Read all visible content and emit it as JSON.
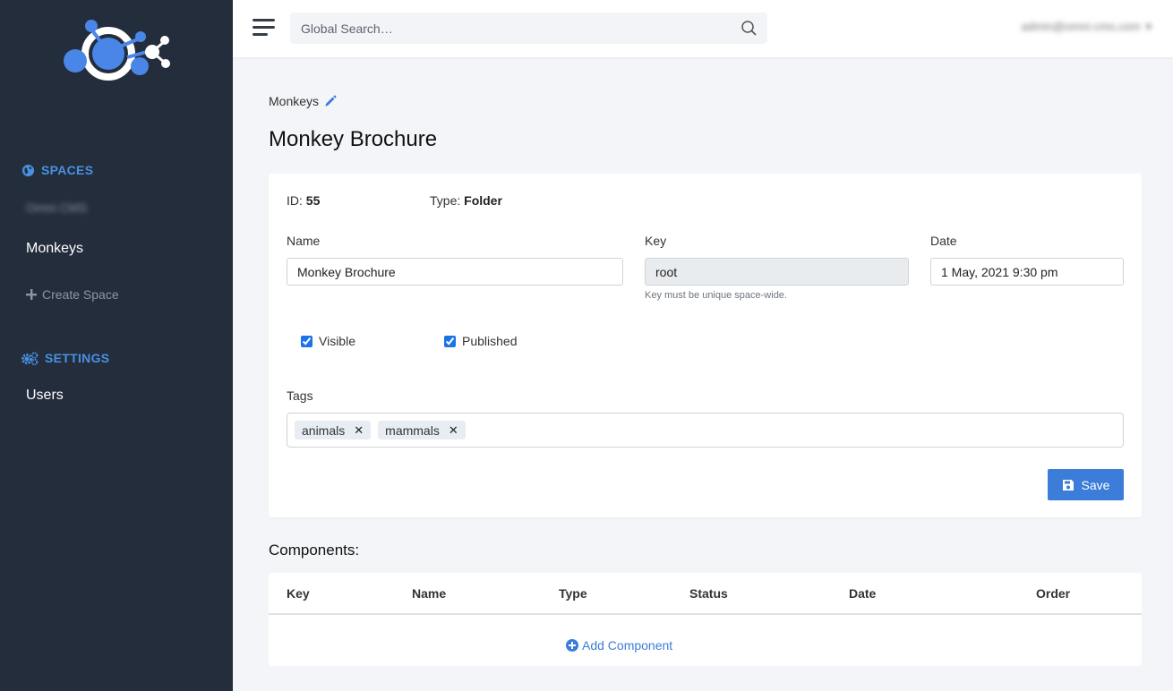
{
  "sidebar": {
    "spaces_heading": "SPACES",
    "spaces": [
      {
        "label": "Omni CMS"
      },
      {
        "label": "Monkeys"
      }
    ],
    "create_space": "Create Space",
    "settings_heading": "SETTINGS",
    "settings_items": [
      {
        "label": "Users"
      }
    ]
  },
  "topbar": {
    "search_placeholder": "Global Search…",
    "user_email": "admin@omni-cms.com"
  },
  "breadcrumb": {
    "label": "Monkeys"
  },
  "page": {
    "title": "Monkey Brochure"
  },
  "form": {
    "id_label": "ID:",
    "id_value": "55",
    "type_label": "Type:",
    "type_value": "Folder",
    "name_label": "Name",
    "name_value": "Monkey Brochure",
    "key_label": "Key",
    "key_value": "root",
    "key_help": "Key must be unique space-wide.",
    "date_label": "Date",
    "date_value": "1 May, 2021 9:30 pm",
    "visible_label": "Visible",
    "published_label": "Published",
    "tags_label": "Tags",
    "tags": [
      {
        "label": "animals"
      },
      {
        "label": "mammals"
      }
    ],
    "save_label": "Save"
  },
  "components": {
    "title": "Components:",
    "columns": [
      "Key",
      "Name",
      "Type",
      "Status",
      "Date",
      "Order"
    ],
    "add_label": "Add Component"
  },
  "colors": {
    "sidebar_bg": "#232d3c",
    "accent": "#3b7dd8",
    "page_bg": "#f4f5f9"
  }
}
